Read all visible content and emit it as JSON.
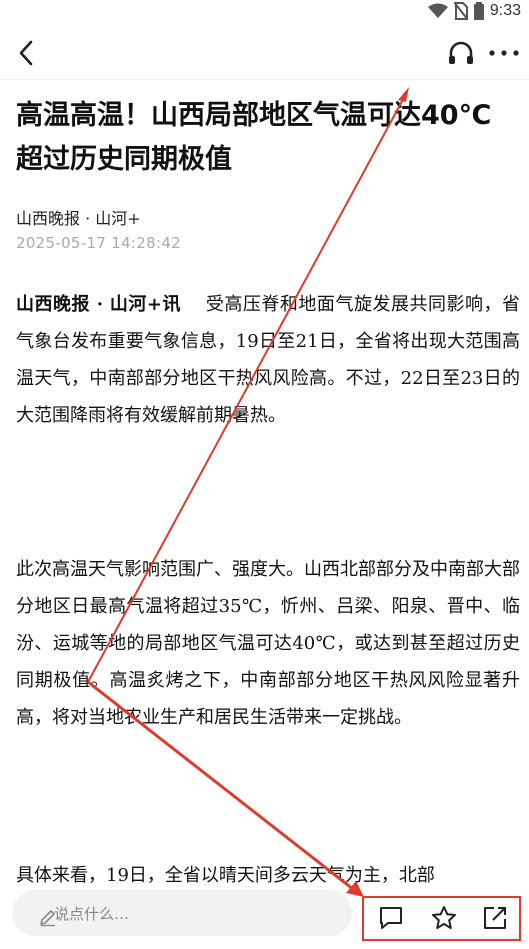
{
  "status_bar": {
    "time": "9:33"
  },
  "icons": {
    "back": "back-arrow-icon",
    "audio": "headphones-icon",
    "more": "more-dots-icon",
    "pencil": "pencil-icon",
    "comment": "comment-icon",
    "favorite": "star-icon",
    "share": "share-icon"
  },
  "article": {
    "title": "高温高温！山西局部地区气温可达40℃ 超过历史同期极值",
    "source": "山西晚报 · 山河+",
    "date": "2025-05-17  14:28:42",
    "p1_lead": "山西晚报 · 山河+讯",
    "p1_body": "受高压脊和地面气旋发展共同影响，省气象台发布重要气象信息，19日至21日，全省将出现大范围高温天气，中南部部分地区干热风风险高。不过，22日至23日的大范围降雨将有效缓解前期暑热。",
    "p2": "此次高温天气影响范围广、强度大。山西北部部分及中南部大部分地区日最高气温将超过35℃，忻州、吕梁、阳泉、晋中、临汾、运城等地的局部地区气温可达40℃，或达到甚至超过历史同期极值。高温炙烤之下，中南部部分地区干热风风险显著升高，将对当地农业生产和居民生活带来一定挑战。",
    "p3": "具体来看，19日，全省以晴天间多云天气为主，北部"
  },
  "bottom_bar": {
    "comment_placeholder": "说点什么…"
  },
  "colors": {
    "annotation": "#e03a2f"
  }
}
